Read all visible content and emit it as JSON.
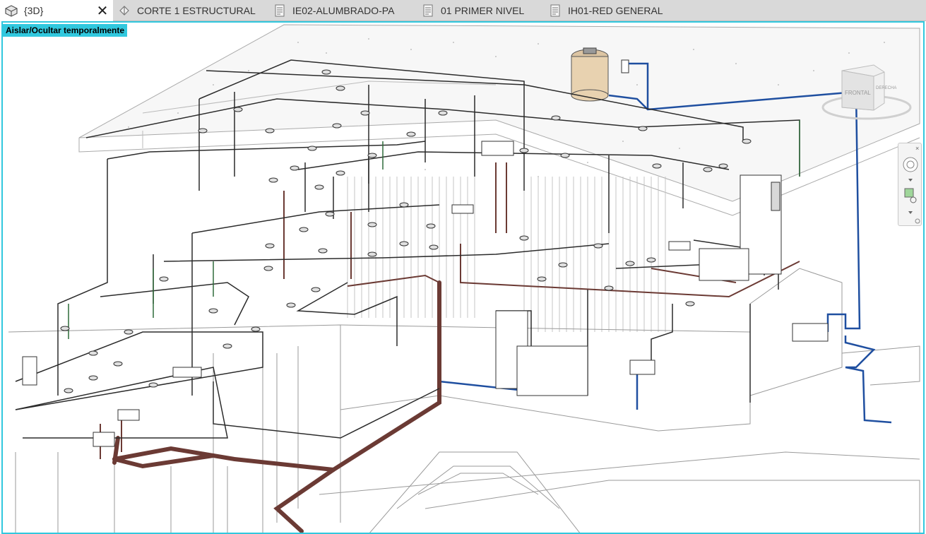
{
  "tabs": [
    {
      "label": "{3D}",
      "icon": "3d-view-icon",
      "active": true
    },
    {
      "label": "CORTE 1 ESTRUCTURAL",
      "icon": "section-view-icon"
    },
    {
      "label": "IE02-ALUMBRADO-PA",
      "icon": "sheet-icon"
    },
    {
      "label": "01 PRIMER NIVEL",
      "icon": "sheet-icon"
    },
    {
      "label": "IH01-RED GENERAL",
      "icon": "sheet-icon"
    }
  ],
  "viewport": {
    "banner": "Aislar/Ocultar temporalmente",
    "border_color": "#31c8de"
  },
  "viewcube": {
    "front_label": "FRONTAL",
    "right_label": "DERECHA"
  },
  "colors": {
    "pipe_sanitary": "#6b3a34",
    "pipe_water": "#1f4fa0",
    "pipe_electrical": "#2b2b2b",
    "pipe_green": "#2f6b3a",
    "tank": "#e8d2b0",
    "structure": "#9a9a9a"
  }
}
